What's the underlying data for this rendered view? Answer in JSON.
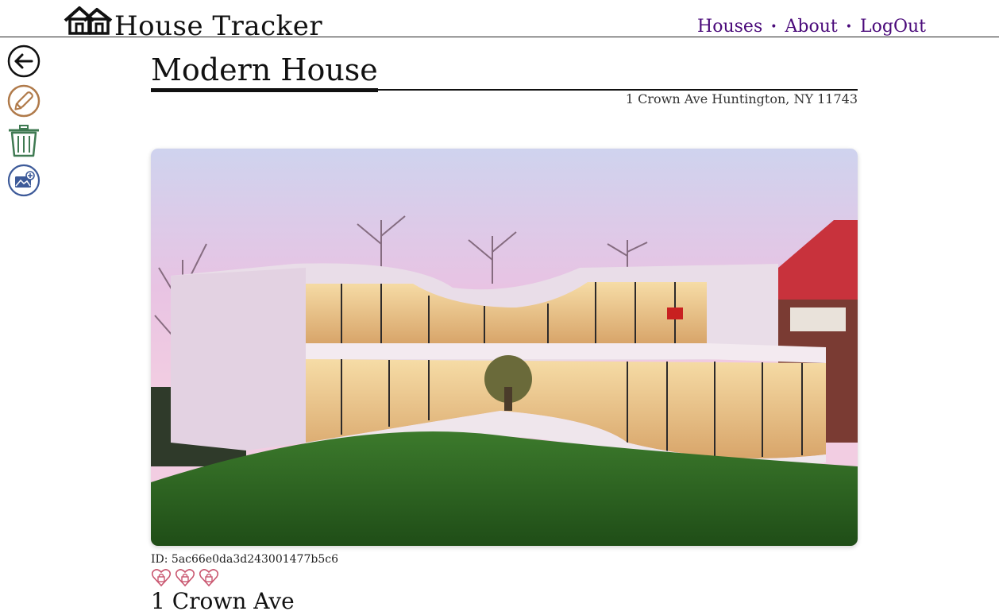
{
  "header": {
    "app_title": "House Tracker",
    "nav": {
      "houses": "Houses",
      "about": "About",
      "logout": "LogOut",
      "separator": "•"
    }
  },
  "actions": [
    "back-icon",
    "edit-icon",
    "trash-icon",
    "add-photo-icon"
  ],
  "house": {
    "title": "Modern House",
    "full_address": "1 Crown Ave Huntington, NY 11743",
    "id_label": "ID: 5ac66e0da3d243001477b5c6",
    "rating_icons": 3,
    "street": "1 Crown Ave"
  },
  "colors": {
    "nav_link": "#4a0a7a",
    "edit_icon": "#b07a4a",
    "trash_icon": "#3f7a52",
    "photo_icon": "#3d5a99",
    "heart_icon": "#c9566f"
  }
}
